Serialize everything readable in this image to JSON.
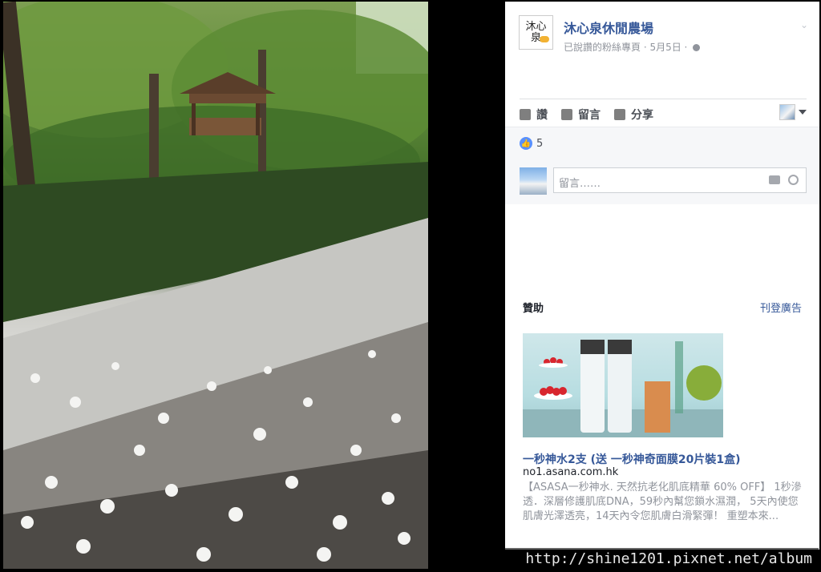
{
  "post": {
    "page_name": "沐心泉休閒農場",
    "meta": "已說讚的粉絲專頁 · 5月5日 ·",
    "avatar_text": "沐心\n泉"
  },
  "actions": {
    "like": "讚",
    "comment": "留言",
    "share": "分享"
  },
  "reactions": {
    "like_count": "5"
  },
  "comment_box": {
    "placeholder": "留言……"
  },
  "sponsored": {
    "label": "贊助",
    "create_ad": "刊登廣告",
    "ad_title": "一秒神水2支 (送 一秒神奇面膜20片裝1盒)",
    "ad_domain": "no1.asana.com.hk",
    "ad_description": "【ASASA一秒神水. 天然抗老化肌底精華 60% OFF】 1秒滲透．深層修護肌底DNA，59秒內幫您鎖水濕潤， 5天內使您肌膚光澤透亮，14天內令您肌膚白滑緊彈！ 重塑本來..."
  },
  "watermark": "http://shine1201.pixnet.net/album",
  "colors": {
    "link": "#365899",
    "meta": "#90949c",
    "like_badge": "#5890ff"
  }
}
